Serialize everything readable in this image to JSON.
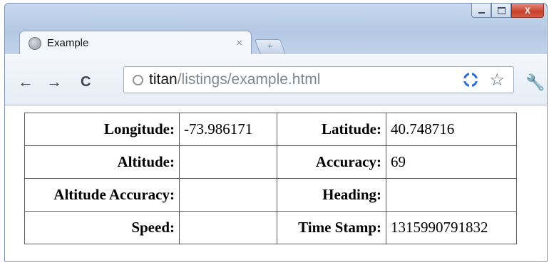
{
  "tab": {
    "title": "Example",
    "close_glyph": "×"
  },
  "newtab_glyph": "+",
  "toolbar": {
    "back_glyph": "←",
    "forward_glyph": "→",
    "reload_glyph": "C",
    "wrench_glyph": "🔧"
  },
  "window_controls": {
    "close_glyph": "X"
  },
  "address": {
    "host": "titan",
    "path": "/listings/example.html",
    "star_glyph": "☆"
  },
  "table": {
    "rows": [
      {
        "label1": "Longitude:",
        "value1": "-73.986171",
        "label2": "Latitude:",
        "value2": "40.748716"
      },
      {
        "label1": "Altitude:",
        "value1": "",
        "label2": "Accuracy:",
        "value2": "69"
      },
      {
        "label1": "Altitude Accuracy:",
        "value1": "",
        "label2": "Heading:",
        "value2": ""
      },
      {
        "label1": "Speed:",
        "value1": "",
        "label2": "Time Stamp:",
        "value2": "1315990791832"
      }
    ]
  }
}
